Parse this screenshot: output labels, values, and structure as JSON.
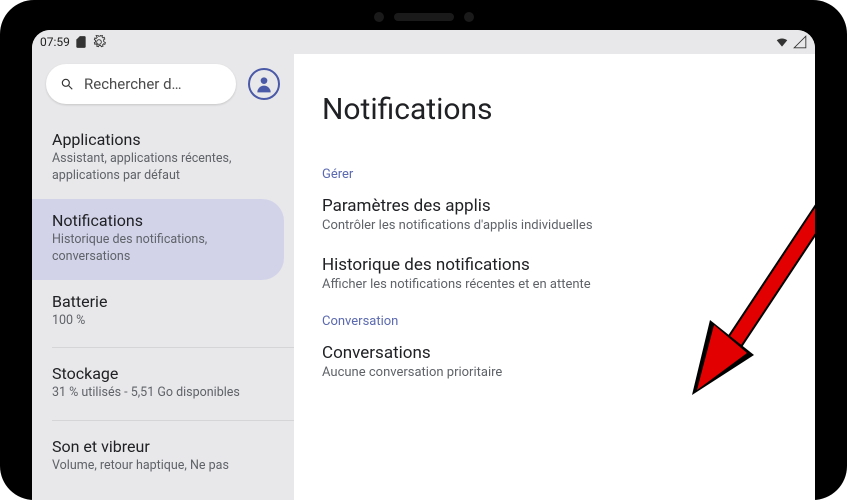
{
  "statusbar": {
    "time": "07:59"
  },
  "search": {
    "placeholder": "Rechercher d…"
  },
  "sidebar": {
    "items": [
      {
        "title": "Applications",
        "sub": "Assistant, applications récentes, applications par défaut"
      },
      {
        "title": "Notifications",
        "sub": "Historique des notifications, conversations"
      },
      {
        "title": "Batterie",
        "sub": "100 %"
      },
      {
        "title": "Stockage",
        "sub": "31 % utilisés - 5,51 Go disponibles"
      },
      {
        "title": "Son et vibreur",
        "sub": "Volume, retour haptique, Ne pas"
      }
    ]
  },
  "main": {
    "heading": "Notifications",
    "section1_label": "Gérer",
    "settings1": [
      {
        "title": "Paramètres des applis",
        "sub": "Contrôler les notifications d'applis individuelles"
      },
      {
        "title": "Historique des notifications",
        "sub": "Afficher les notifications récentes et en attente"
      }
    ],
    "section2_label": "Conversation",
    "settings2": [
      {
        "title": "Conversations",
        "sub": "Aucune conversation prioritaire"
      }
    ]
  }
}
